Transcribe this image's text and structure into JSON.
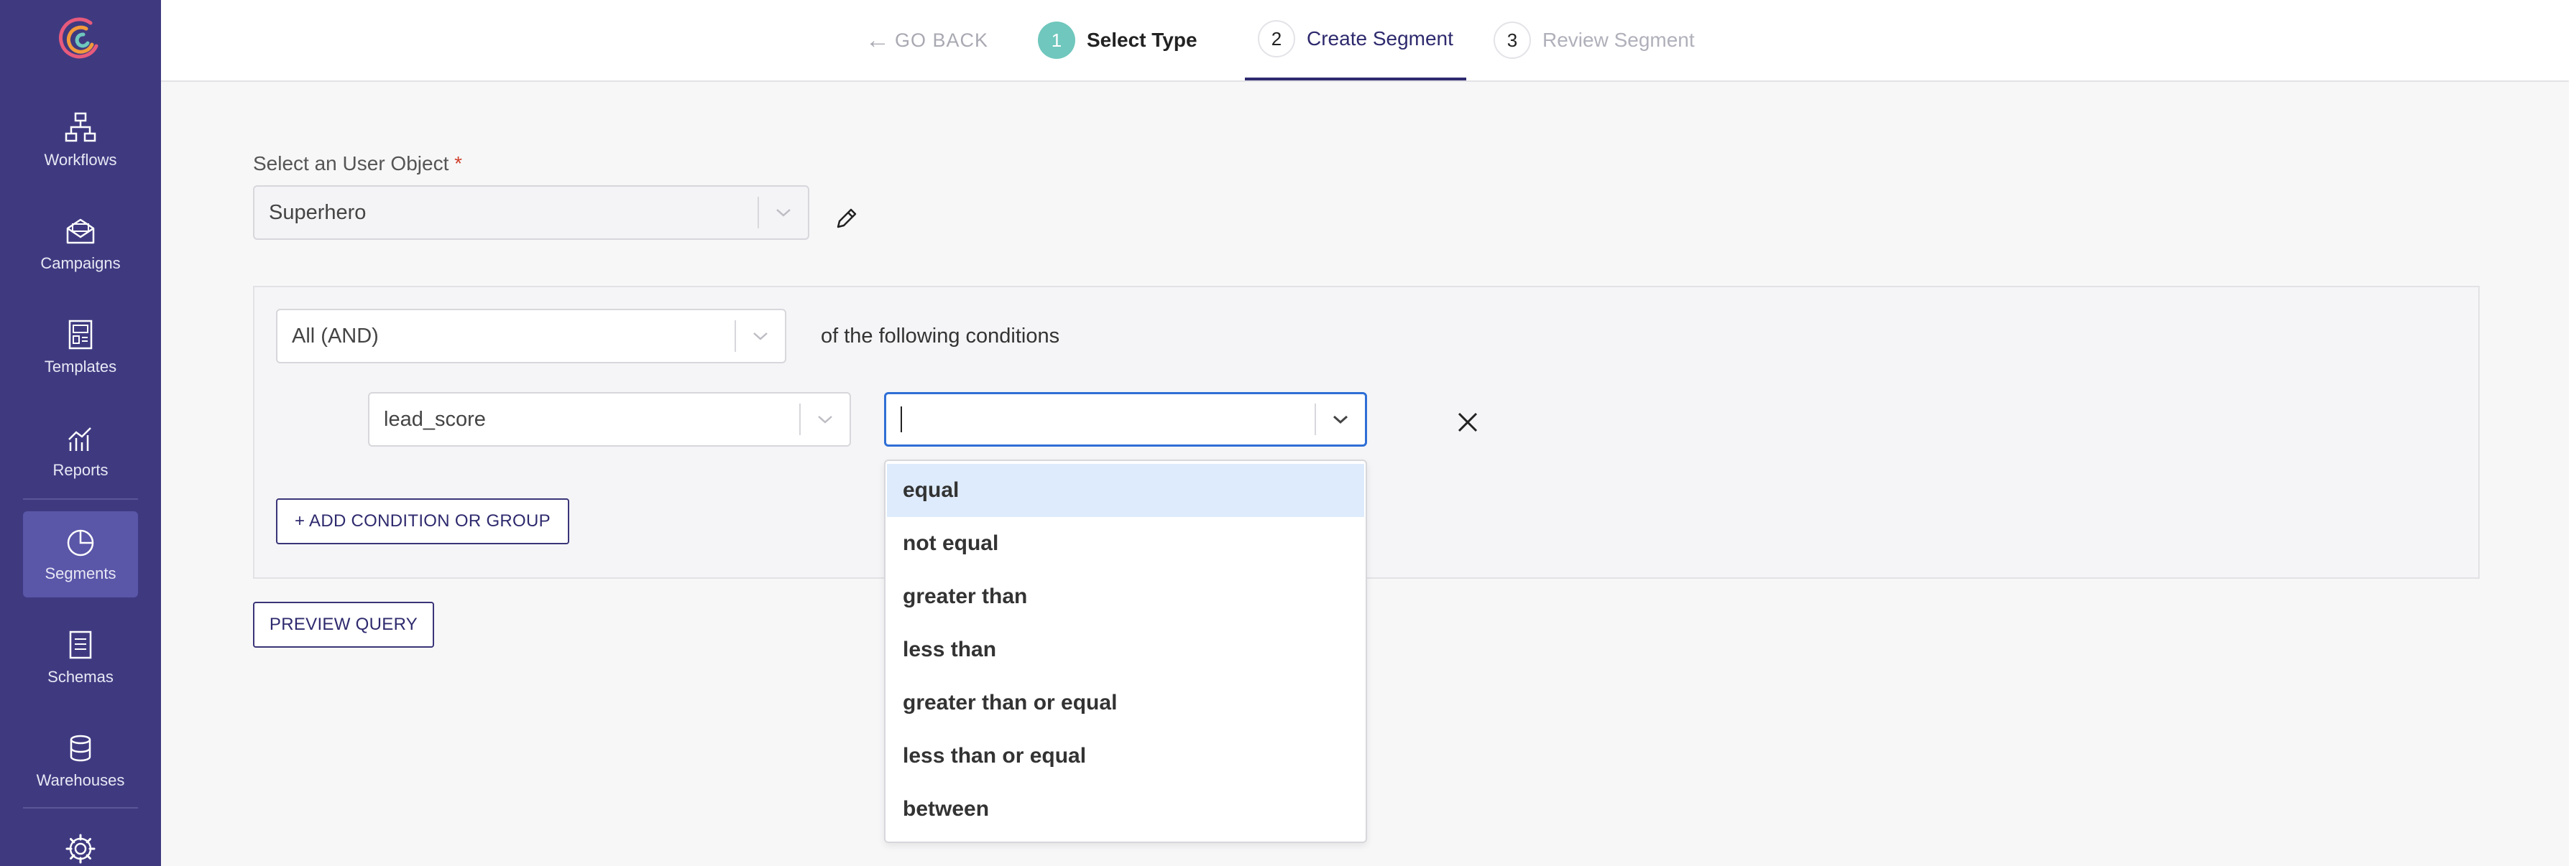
{
  "sidebar": {
    "items": [
      {
        "label": "Workflows",
        "icon": "workflow-icon"
      },
      {
        "label": "Campaigns",
        "icon": "envelope-icon"
      },
      {
        "label": "Templates",
        "icon": "template-icon"
      },
      {
        "label": "Reports",
        "icon": "chart-icon"
      },
      {
        "label": "Segments",
        "icon": "pie-chart-icon",
        "active": true
      },
      {
        "label": "Schemas",
        "icon": "document-icon"
      },
      {
        "label": "Warehouses",
        "icon": "database-icon"
      }
    ],
    "settings_icon": "gear-icon"
  },
  "stepper": {
    "go_back": "GO BACK",
    "steps": [
      {
        "number": "1",
        "label": "Select Type",
        "state": "completed"
      },
      {
        "number": "2",
        "label": "Create Segment",
        "state": "active"
      },
      {
        "number": "3",
        "label": "Review Segment",
        "state": "upcoming"
      }
    ]
  },
  "form": {
    "user_object_label": "Select an User Object",
    "required_mark": "*",
    "user_object_value": "Superhero",
    "match_value": "All (AND)",
    "match_suffix": "of the following conditions",
    "field_value": "lead_score",
    "operator_value": "",
    "add_condition": "+ ADD CONDITION OR GROUP",
    "preview_query": "PREVIEW QUERY"
  },
  "operator_options": [
    "equal",
    "not equal",
    "greater than",
    "less than",
    "greater than or equal",
    "less than or equal",
    "between"
  ],
  "colors": {
    "sidebar": "#3f3a80",
    "sidebar_active": "#5a56a8",
    "accent": "#2e2a6e",
    "step_done": "#6fc7bd",
    "focus": "#2f6fd6",
    "highlight": "#deebfc"
  }
}
